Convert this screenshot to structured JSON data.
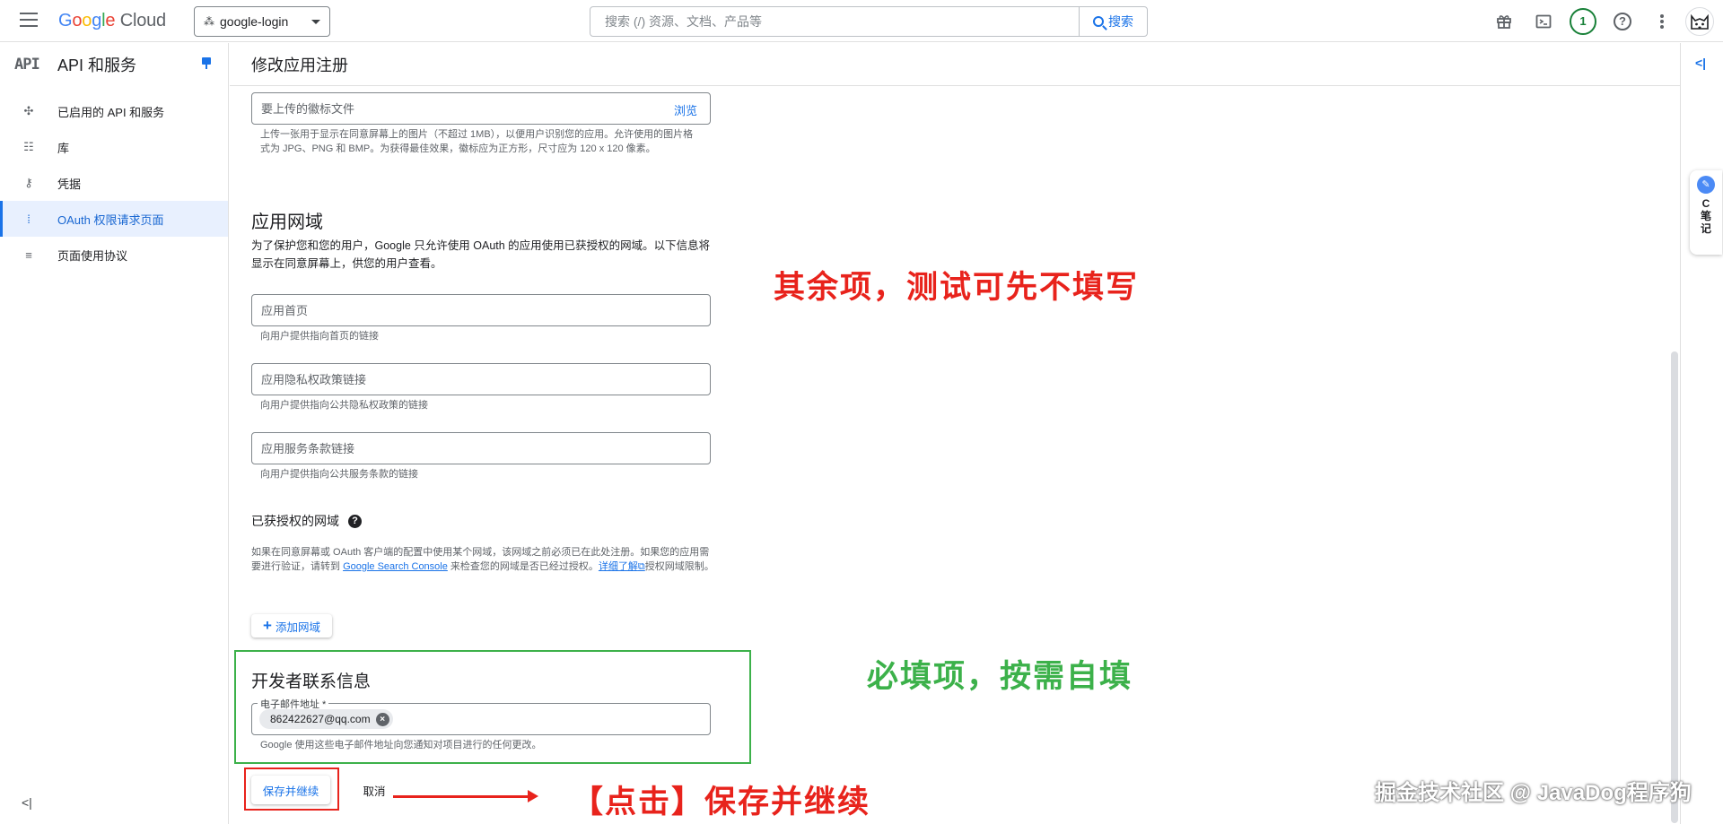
{
  "topbar": {
    "logo_google": [
      "G",
      "o",
      "o",
      "g",
      "l",
      "e"
    ],
    "logo_cloud": "Cloud",
    "project": "google-login",
    "search_placeholder": "搜索 (/) 资源、文档、产品等",
    "search_button": "搜索",
    "notification_count": "1",
    "help_symbol": "?"
  },
  "sidebar": {
    "mark": "API",
    "title": "API 和服务",
    "items": [
      {
        "label": "已启用的 API 和服务",
        "icon": "api-diamond-icon",
        "active": false
      },
      {
        "label": "库",
        "icon": "library-icon",
        "active": false
      },
      {
        "label": "凭据",
        "icon": "key-icon",
        "active": false
      },
      {
        "label": "OAuth 权限请求页面",
        "icon": "consent-icon",
        "active": true
      },
      {
        "label": "页面使用协议",
        "icon": "settings-list-icon",
        "active": false
      }
    ]
  },
  "page": {
    "title": "修改应用注册"
  },
  "logo_upload": {
    "placeholder": "要上传的徽标文件",
    "browse": "浏览",
    "hint": "上传一张用于显示在同意屏幕上的图片（不超过 1MB），以便用户识别您的应用。允许使用的图片格式为 JPG、PNG 和 BMP。为获得最佳效果，徽标应为正方形，尺寸应为 120 x 120 像素。"
  },
  "app_domain": {
    "title": "应用网域",
    "description": "为了保护您和您的用户，Google 只允许使用 OAuth 的应用使用已获授权的网域。以下信息将显示在同意屏幕上，供您的用户查看。",
    "homepage_placeholder": "应用首页",
    "homepage_hint": "向用户提供指向首页的链接",
    "privacy_placeholder": "应用隐私权政策链接",
    "privacy_hint": "向用户提供指向公共隐私权政策的链接",
    "tos_placeholder": "应用服务条款链接",
    "tos_hint": "向用户提供指向公共服务条款的链接"
  },
  "authorized_domains": {
    "title": "已获授权的网域",
    "text_1": "如果在同意屏幕或 OAuth 客户端的配置中使用某个网域，该网域之前必须已在此处注册。如果您的应用需要进行验证，请转到 ",
    "link_console": "Google Search Console",
    "text_2": " 来检查您的网域是否已经过授权。",
    "link_learn": "详细了解",
    "text_3": "授权网域限制。",
    "add_button": "添加网域"
  },
  "developer_contact": {
    "title": "开发者联系信息",
    "email_label": "电子邮件地址 *",
    "email_chip": "862422627@qq.com",
    "hint": "Google 使用这些电子邮件地址向您通知对项目进行的任何更改。"
  },
  "actions": {
    "save": "保存并继续",
    "cancel": "取消"
  },
  "note_widget": {
    "text": "C笔记"
  },
  "annotations": {
    "optional": "其余项，测试可先不填写",
    "required": "必填项，按需自填",
    "click": "【点击】保存并继续",
    "watermark": "掘金技术社区 @ JavaDog程序狗"
  },
  "colors": {
    "accent": "#1a73e8",
    "annotation_red": "#e8231c",
    "annotation_green": "#3cb14a"
  }
}
